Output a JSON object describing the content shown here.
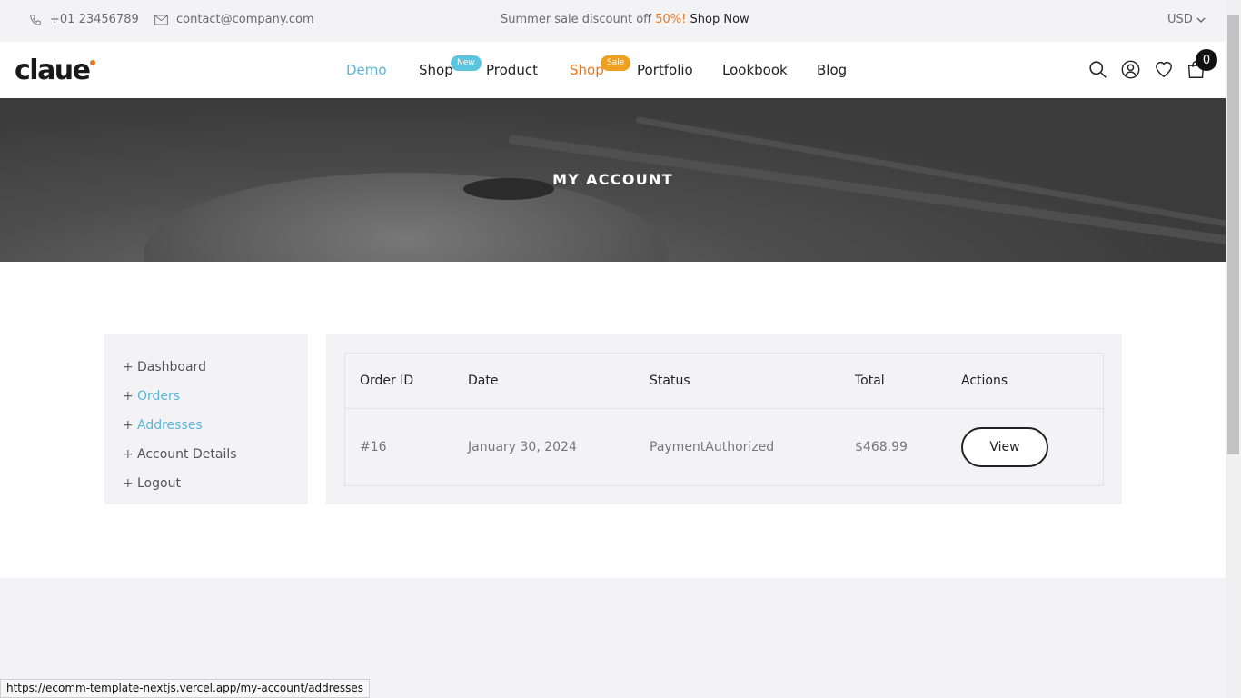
{
  "topbar": {
    "phone": "+01 23456789",
    "email": "contact@company.com",
    "promo_text": "Summer sale discount off ",
    "promo_pct": "50%!",
    "promo_link": "Shop Now",
    "currency": "USD"
  },
  "header": {
    "logo": "claue",
    "nav": [
      {
        "label": "Demo"
      },
      {
        "label": "Shop",
        "badge": "New"
      },
      {
        "label": "Product"
      },
      {
        "label": "Shop",
        "badge": "Sale"
      },
      {
        "label": "Portfolio"
      },
      {
        "label": "Lookbook"
      },
      {
        "label": "Blog"
      }
    ],
    "cart_count": "0"
  },
  "hero": {
    "title": "MY ACCOUNT"
  },
  "sidebar": {
    "items": [
      {
        "label": "Dashboard"
      },
      {
        "label": "Orders"
      },
      {
        "label": "Addresses"
      },
      {
        "label": "Account Details"
      },
      {
        "label": "Logout"
      }
    ]
  },
  "orders": {
    "headers": [
      "Order ID",
      "Date",
      "Status",
      "Total",
      "Actions"
    ],
    "rows": [
      {
        "id": "#16",
        "date": "January 30, 2024",
        "status": "PaymentAuthorized",
        "total": "$468.99",
        "action": "View"
      }
    ]
  },
  "statusbar": {
    "url": "https://ecomm-template-nextjs.vercel.app/my-account/addresses"
  },
  "colors": {
    "accent": "#5bb5d5",
    "orange": "#e8771f",
    "sale_badge": "#f0a020",
    "new_badge": "#5bc5dd"
  }
}
